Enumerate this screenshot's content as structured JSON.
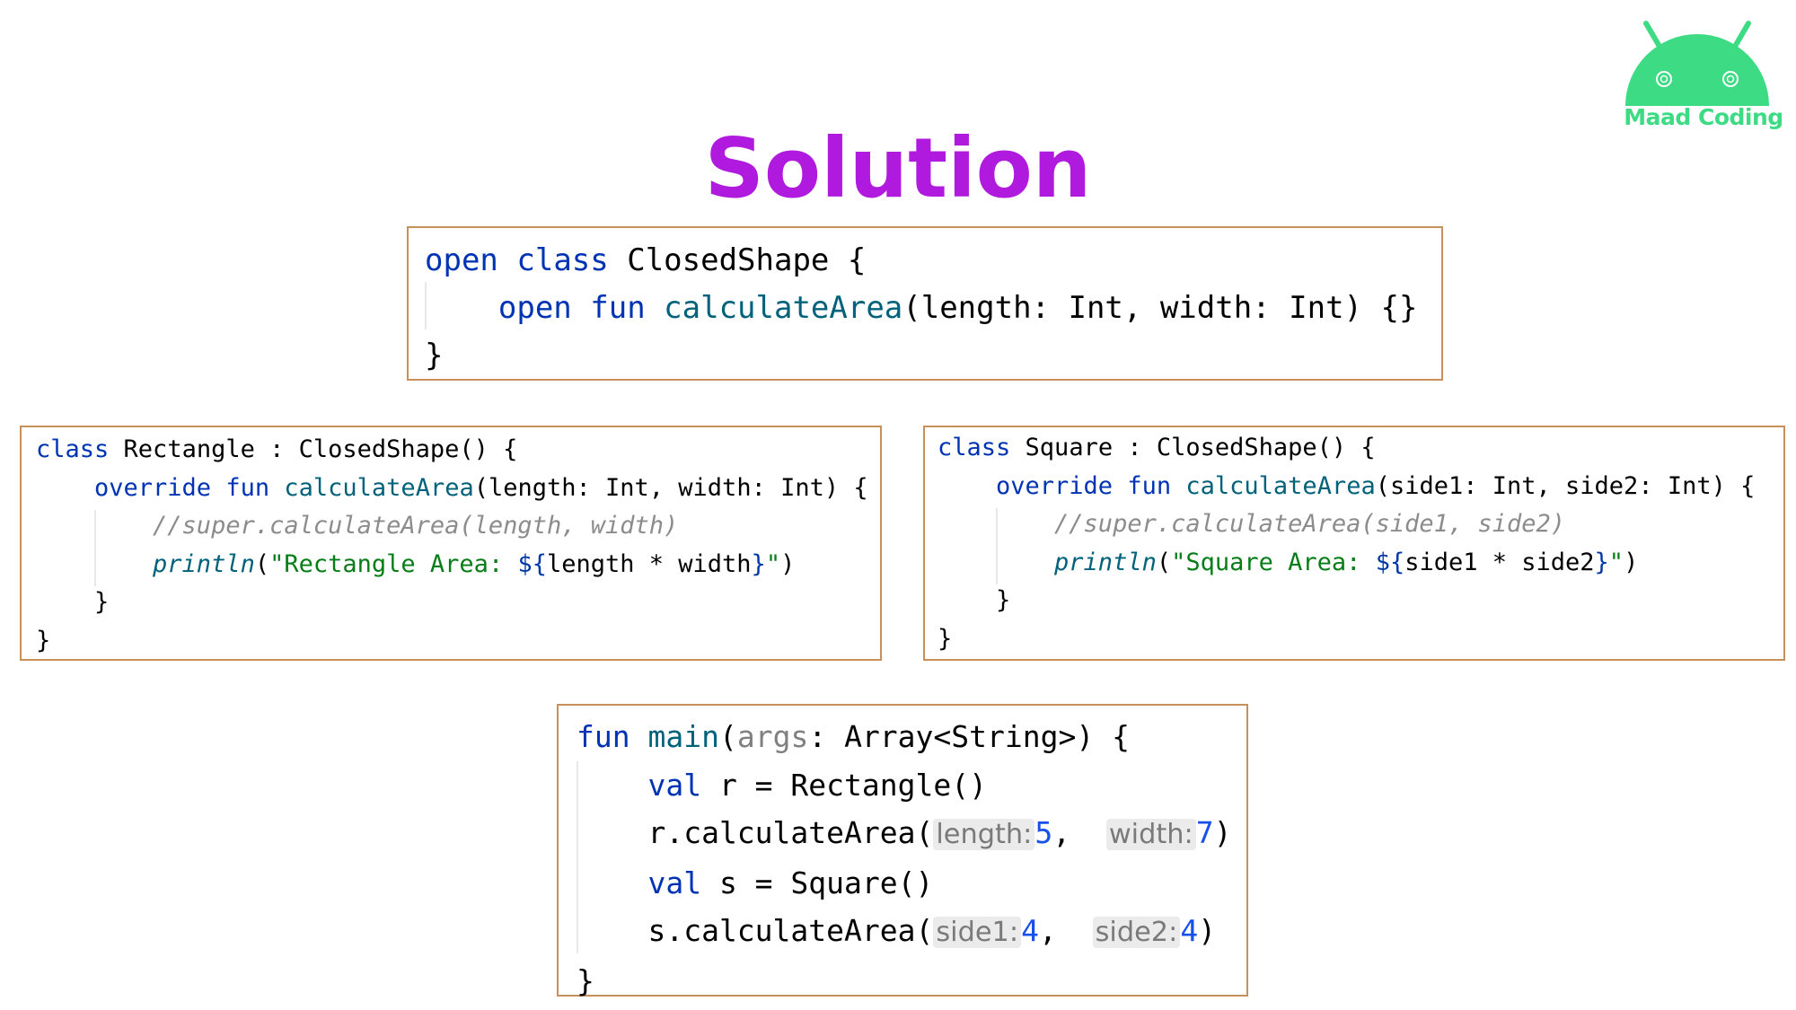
{
  "title": "Solution",
  "logo": {
    "text": "Maad Coding",
    "color": "#3ddc84"
  },
  "colors": {
    "title": "#b019de",
    "border": "#c8905a",
    "keyword": "#0033b3",
    "function": "#00627a",
    "string": "#067d17",
    "comment": "#8c8c8c",
    "number": "#1750eb"
  },
  "closed_shape": {
    "l1": [
      "open",
      "class",
      "ClosedShape {"
    ],
    "l2": [
      "    open",
      "fun",
      "calculateArea",
      "(length: Int, width: Int) {}"
    ],
    "l3": "}"
  },
  "rectangle": {
    "l1": [
      "class",
      "Rectangle : ClosedShape() {"
    ],
    "l2": [
      "    override",
      "fun",
      "calculateArea",
      "(length: Int, width: Int) {"
    ],
    "l3": "        //super.calculateArea(length, width)",
    "l4": [
      "        println",
      "(",
      "\"Rectangle Area: ",
      "${",
      "length * width",
      "}",
      "\"",
      ")"
    ],
    "l5": "    }",
    "l6": "}"
  },
  "square": {
    "l1": [
      "class",
      "Square : ClosedShape() {"
    ],
    "l2": [
      "    override",
      "fun",
      "calculateArea",
      "(side1: Int, side2: Int) {"
    ],
    "l3": "        //super.calculateArea(side1, side2)",
    "l4": [
      "        println",
      "(",
      "\"Square Area: ",
      "${",
      "side1 * side2",
      "}",
      "\"",
      ")"
    ],
    "l5": "    }",
    "l6": "}"
  },
  "main": {
    "l1": [
      "fun",
      "main",
      "(",
      "args",
      ": Array<String>) {"
    ],
    "l2": [
      "    val",
      " r = Rectangle()"
    ],
    "l3": [
      "    r.calculateArea(",
      "length:",
      "5",
      ",  ",
      "width:",
      "7",
      ")"
    ],
    "l4": [
      "    val",
      " s = Square()"
    ],
    "l5": [
      "    s.calculateArea(",
      "side1:",
      "4",
      ",  ",
      "side2:",
      "4",
      ")"
    ],
    "l6": "}"
  }
}
